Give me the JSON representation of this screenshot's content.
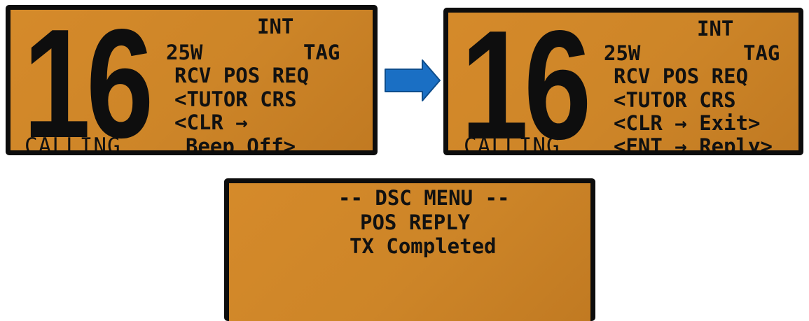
{
  "screen_before": {
    "channel": "16",
    "mode": "INT",
    "power": "25W",
    "tag": "TAG",
    "line1": "RCV POS REQ",
    "line2": "<TUTOR CRS",
    "line3": "<CLR →",
    "line4": "Beep Off>",
    "status": "CALLING"
  },
  "screen_after": {
    "channel": "16",
    "mode": "INT",
    "power": "25W",
    "tag": "TAG",
    "line1": "RCV POS REQ",
    "line2": "<TUTOR CRS",
    "line3": "<CLR → Exit>",
    "line4": "<ENT → Reply>",
    "status": "CALLING"
  },
  "screen_result": {
    "title": "-- DSC MENU --",
    "line1": "POS REPLY",
    "line2": "TX Completed"
  },
  "colors": {
    "lcd_background": "#cd8528",
    "lcd_bezel": "#0d0d0d",
    "arrow": "#1a6fc4"
  },
  "icons": {
    "transition": "right-arrow-icon"
  }
}
